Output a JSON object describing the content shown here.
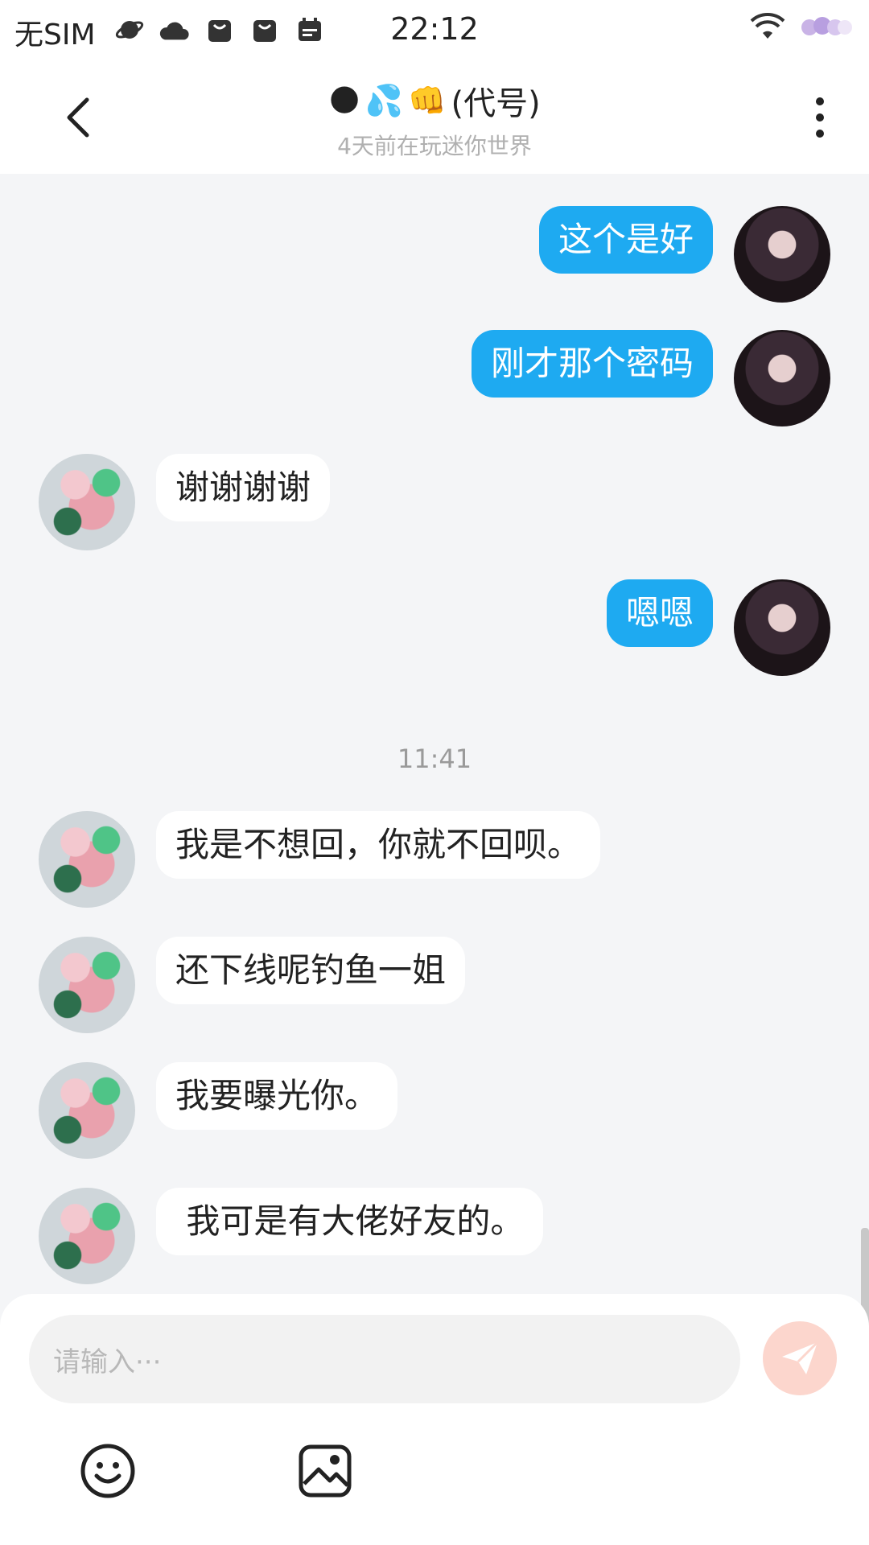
{
  "status_bar": {
    "carrier": "无SIM",
    "time": "22:12",
    "icons": [
      "saturn-icon",
      "cloud-icon",
      "shopping-bag-icon",
      "shopping-bag-icon",
      "calendar-icon"
    ],
    "right_icons": [
      "wifi-icon",
      "clouds-icon"
    ]
  },
  "header": {
    "title_emojis": [
      "🌑",
      "💦",
      "👊"
    ],
    "title_text": "(代号)",
    "subtitle": "4天前在玩迷你世界"
  },
  "messages": [
    {
      "from": "me",
      "text": "这个是好"
    },
    {
      "from": "me",
      "text": "刚才那个密码"
    },
    {
      "from": "other",
      "text": "谢谢谢谢"
    },
    {
      "from": "me",
      "text": "嗯嗯"
    },
    {
      "from": "other",
      "text": "我是不想回，你就不回呗。"
    },
    {
      "from": "other",
      "text": "还下线呢钓鱼一姐"
    },
    {
      "from": "other",
      "text": "我要曝光你。"
    },
    {
      "from": "other",
      "text": " 我可是有大佬好友的。"
    }
  ],
  "timestamp": "11:41",
  "composer": {
    "placeholder": "请输入···",
    "tools": [
      "smiley-icon",
      "image-icon"
    ]
  },
  "colors": {
    "bubble_me": "#1eaaf1",
    "bubble_other": "#ffffff",
    "background": "#f4f5f7",
    "send_button": "#fcd6cd"
  }
}
